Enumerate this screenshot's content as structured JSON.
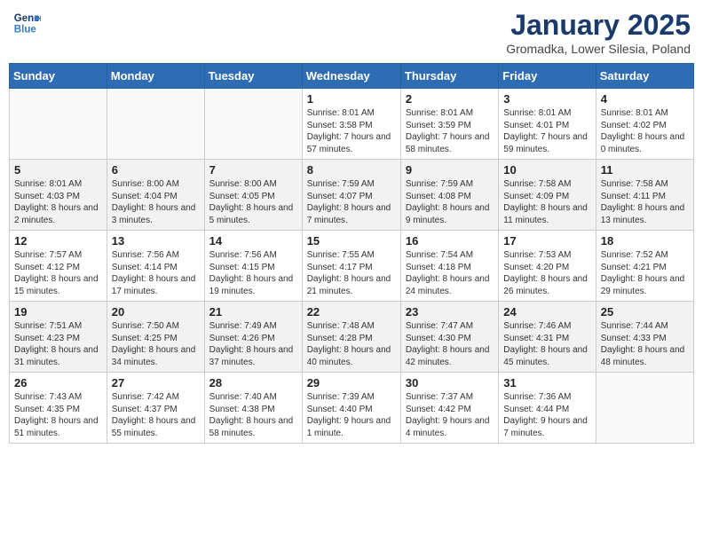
{
  "header": {
    "logo_line1": "General",
    "logo_line2": "Blue",
    "month": "January 2025",
    "location": "Gromadka, Lower Silesia, Poland"
  },
  "weekdays": [
    "Sunday",
    "Monday",
    "Tuesday",
    "Wednesday",
    "Thursday",
    "Friday",
    "Saturday"
  ],
  "weeks": [
    [
      {
        "day": "",
        "text": ""
      },
      {
        "day": "",
        "text": ""
      },
      {
        "day": "",
        "text": ""
      },
      {
        "day": "1",
        "text": "Sunrise: 8:01 AM\nSunset: 3:58 PM\nDaylight: 7 hours and 57 minutes."
      },
      {
        "day": "2",
        "text": "Sunrise: 8:01 AM\nSunset: 3:59 PM\nDaylight: 7 hours and 58 minutes."
      },
      {
        "day": "3",
        "text": "Sunrise: 8:01 AM\nSunset: 4:01 PM\nDaylight: 7 hours and 59 minutes."
      },
      {
        "day": "4",
        "text": "Sunrise: 8:01 AM\nSunset: 4:02 PM\nDaylight: 8 hours and 0 minutes."
      }
    ],
    [
      {
        "day": "5",
        "text": "Sunrise: 8:01 AM\nSunset: 4:03 PM\nDaylight: 8 hours and 2 minutes."
      },
      {
        "day": "6",
        "text": "Sunrise: 8:00 AM\nSunset: 4:04 PM\nDaylight: 8 hours and 3 minutes."
      },
      {
        "day": "7",
        "text": "Sunrise: 8:00 AM\nSunset: 4:05 PM\nDaylight: 8 hours and 5 minutes."
      },
      {
        "day": "8",
        "text": "Sunrise: 7:59 AM\nSunset: 4:07 PM\nDaylight: 8 hours and 7 minutes."
      },
      {
        "day": "9",
        "text": "Sunrise: 7:59 AM\nSunset: 4:08 PM\nDaylight: 8 hours and 9 minutes."
      },
      {
        "day": "10",
        "text": "Sunrise: 7:58 AM\nSunset: 4:09 PM\nDaylight: 8 hours and 11 minutes."
      },
      {
        "day": "11",
        "text": "Sunrise: 7:58 AM\nSunset: 4:11 PM\nDaylight: 8 hours and 13 minutes."
      }
    ],
    [
      {
        "day": "12",
        "text": "Sunrise: 7:57 AM\nSunset: 4:12 PM\nDaylight: 8 hours and 15 minutes."
      },
      {
        "day": "13",
        "text": "Sunrise: 7:56 AM\nSunset: 4:14 PM\nDaylight: 8 hours and 17 minutes."
      },
      {
        "day": "14",
        "text": "Sunrise: 7:56 AM\nSunset: 4:15 PM\nDaylight: 8 hours and 19 minutes."
      },
      {
        "day": "15",
        "text": "Sunrise: 7:55 AM\nSunset: 4:17 PM\nDaylight: 8 hours and 21 minutes."
      },
      {
        "day": "16",
        "text": "Sunrise: 7:54 AM\nSunset: 4:18 PM\nDaylight: 8 hours and 24 minutes."
      },
      {
        "day": "17",
        "text": "Sunrise: 7:53 AM\nSunset: 4:20 PM\nDaylight: 8 hours and 26 minutes."
      },
      {
        "day": "18",
        "text": "Sunrise: 7:52 AM\nSunset: 4:21 PM\nDaylight: 8 hours and 29 minutes."
      }
    ],
    [
      {
        "day": "19",
        "text": "Sunrise: 7:51 AM\nSunset: 4:23 PM\nDaylight: 8 hours and 31 minutes."
      },
      {
        "day": "20",
        "text": "Sunrise: 7:50 AM\nSunset: 4:25 PM\nDaylight: 8 hours and 34 minutes."
      },
      {
        "day": "21",
        "text": "Sunrise: 7:49 AM\nSunset: 4:26 PM\nDaylight: 8 hours and 37 minutes."
      },
      {
        "day": "22",
        "text": "Sunrise: 7:48 AM\nSunset: 4:28 PM\nDaylight: 8 hours and 40 minutes."
      },
      {
        "day": "23",
        "text": "Sunrise: 7:47 AM\nSunset: 4:30 PM\nDaylight: 8 hours and 42 minutes."
      },
      {
        "day": "24",
        "text": "Sunrise: 7:46 AM\nSunset: 4:31 PM\nDaylight: 8 hours and 45 minutes."
      },
      {
        "day": "25",
        "text": "Sunrise: 7:44 AM\nSunset: 4:33 PM\nDaylight: 8 hours and 48 minutes."
      }
    ],
    [
      {
        "day": "26",
        "text": "Sunrise: 7:43 AM\nSunset: 4:35 PM\nDaylight: 8 hours and 51 minutes."
      },
      {
        "day": "27",
        "text": "Sunrise: 7:42 AM\nSunset: 4:37 PM\nDaylight: 8 hours and 55 minutes."
      },
      {
        "day": "28",
        "text": "Sunrise: 7:40 AM\nSunset: 4:38 PM\nDaylight: 8 hours and 58 minutes."
      },
      {
        "day": "29",
        "text": "Sunrise: 7:39 AM\nSunset: 4:40 PM\nDaylight: 9 hours and 1 minute."
      },
      {
        "day": "30",
        "text": "Sunrise: 7:37 AM\nSunset: 4:42 PM\nDaylight: 9 hours and 4 minutes."
      },
      {
        "day": "31",
        "text": "Sunrise: 7:36 AM\nSunset: 4:44 PM\nDaylight: 9 hours and 7 minutes."
      },
      {
        "day": "",
        "text": ""
      }
    ]
  ]
}
